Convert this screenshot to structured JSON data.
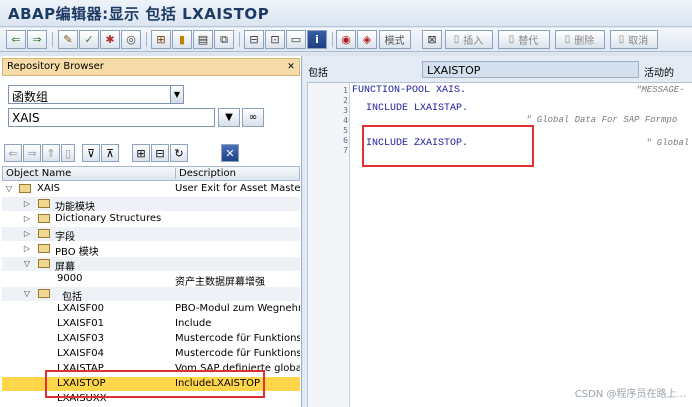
{
  "window": {
    "title": "ABAP编辑器:显示 包括 LXAISTOP"
  },
  "toolbar": {
    "mode_label": "模式",
    "insert_label": "插入",
    "replace_label": "替代",
    "delete_label": "删除",
    "cancel_label": "取消"
  },
  "left_panel": {
    "header": "Repository Browser",
    "object_type": "函数组",
    "object_name": "XAIS",
    "columns": [
      "Object Name",
      "Description"
    ],
    "tree": [
      {
        "name": "XAIS",
        "desc": "User Exit for Asset Master",
        "expand": "open"
      },
      {
        "name": "功能模块",
        "desc": "",
        "expand": "closed"
      },
      {
        "name": "Dictionary Structures",
        "desc": "",
        "expand": "closed"
      },
      {
        "name": "字段",
        "desc": "",
        "expand": "closed"
      },
      {
        "name": "PBO 模块",
        "desc": "",
        "expand": "closed"
      },
      {
        "name": "屏幕",
        "desc": "",
        "expand": "open"
      },
      {
        "name": "9000",
        "desc": "资产主数据屏幕增强",
        "expand": ""
      },
      {
        "name": "包括",
        "desc": "",
        "expand": "open"
      },
      {
        "name": "LXAISF00",
        "desc": "PBO-Modul zum Wegnehmen",
        "expand": ""
      },
      {
        "name": "LXAISF01",
        "desc": "Include",
        "expand": ""
      },
      {
        "name": "LXAISF03",
        "desc": "Mustercode für Funktionsb",
        "expand": ""
      },
      {
        "name": "LXAISF04",
        "desc": "Mustercode für Funktionsb",
        "expand": ""
      },
      {
        "name": "LXAISTAP",
        "desc": "Vom SAP definierte globale",
        "expand": ""
      },
      {
        "name": "LXAISTOP",
        "desc": "IncludeLXAISTOP",
        "expand": ""
      },
      {
        "name": "LXAISUXX",
        "desc": "",
        "expand": ""
      }
    ]
  },
  "right_panel": {
    "include_label": "包括",
    "include_name": "LXAISTOP",
    "status": "活动的"
  },
  "editor": {
    "line_numbers": [
      "1",
      "2",
      "3",
      "4",
      "5",
      "6",
      "7"
    ],
    "lines": [
      "FUNCTION-POOL XAIS.",
      "",
      "  INCLUDE LXAISTAP.",
      "",
      "",
      "  INCLUDE ZXAISTOP.",
      ""
    ],
    "comments": [
      "\"MESSAGE-",
      "\" Global Data For SAP Formpo",
      "\" Global"
    ]
  },
  "watermark": "CSDN @程序员在路上..."
}
